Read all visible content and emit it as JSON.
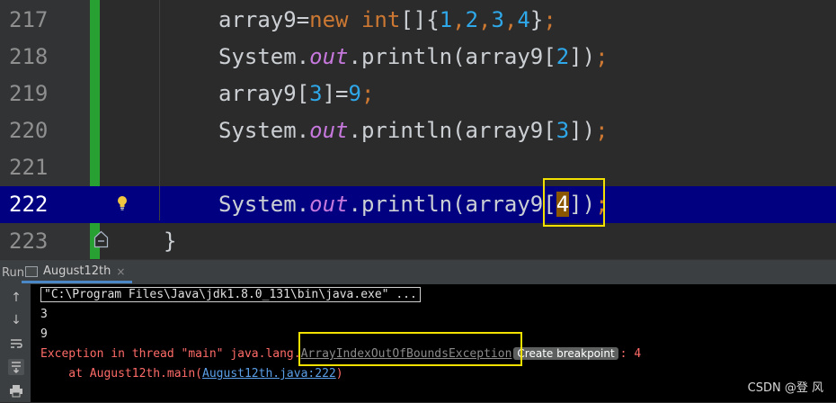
{
  "editor": {
    "lines": [
      {
        "number": "217",
        "parts": [
          "array9=",
          "new",
          " ",
          "int",
          "[]{",
          "1",
          ",",
          "2",
          ",",
          "3",
          ",",
          "4",
          "}",
          ";"
        ]
      },
      {
        "number": "218",
        "parts": [
          "System.",
          "out",
          ".println(array9[",
          "2",
          "])",
          ";"
        ]
      },
      {
        "number": "219",
        "parts": [
          "array9[",
          "3",
          "]=",
          "9",
          ";"
        ]
      },
      {
        "number": "220",
        "parts": [
          "System.",
          "out",
          ".println(array9[",
          "3",
          "])",
          ";"
        ]
      },
      {
        "number": "221",
        "parts": []
      },
      {
        "number": "222",
        "parts": [
          "System.",
          "out",
          ".println(array9[",
          "4",
          "])",
          ";"
        ]
      },
      {
        "number": "223",
        "parts": [
          "}"
        ]
      }
    ],
    "current_line": "222"
  },
  "run_panel": {
    "label": "Run:",
    "tab": "August12th"
  },
  "console": {
    "command": "\"C:\\Program Files\\Java\\jdk1.8.0_131\\bin\\java.exe\" ...",
    "out1": "3",
    "out2": "9",
    "exception_prefix": "Exception in thread \"main\" java.lang.",
    "exception_class": "ArrayIndexOutOfBoundsException",
    "breakpoint_badge": "Create breakpoint",
    "exception_suffix": ": 4",
    "trace_prefix": "    at August12th.main(",
    "trace_link": "August12th.java:222",
    "trace_suffix": ")"
  },
  "watermark": "CSDN @登 风",
  "colors": {
    "vcs_added": "#29a032",
    "current_line": "#000080",
    "highlight_box": "#f2e000",
    "error": "#ff6b68"
  }
}
